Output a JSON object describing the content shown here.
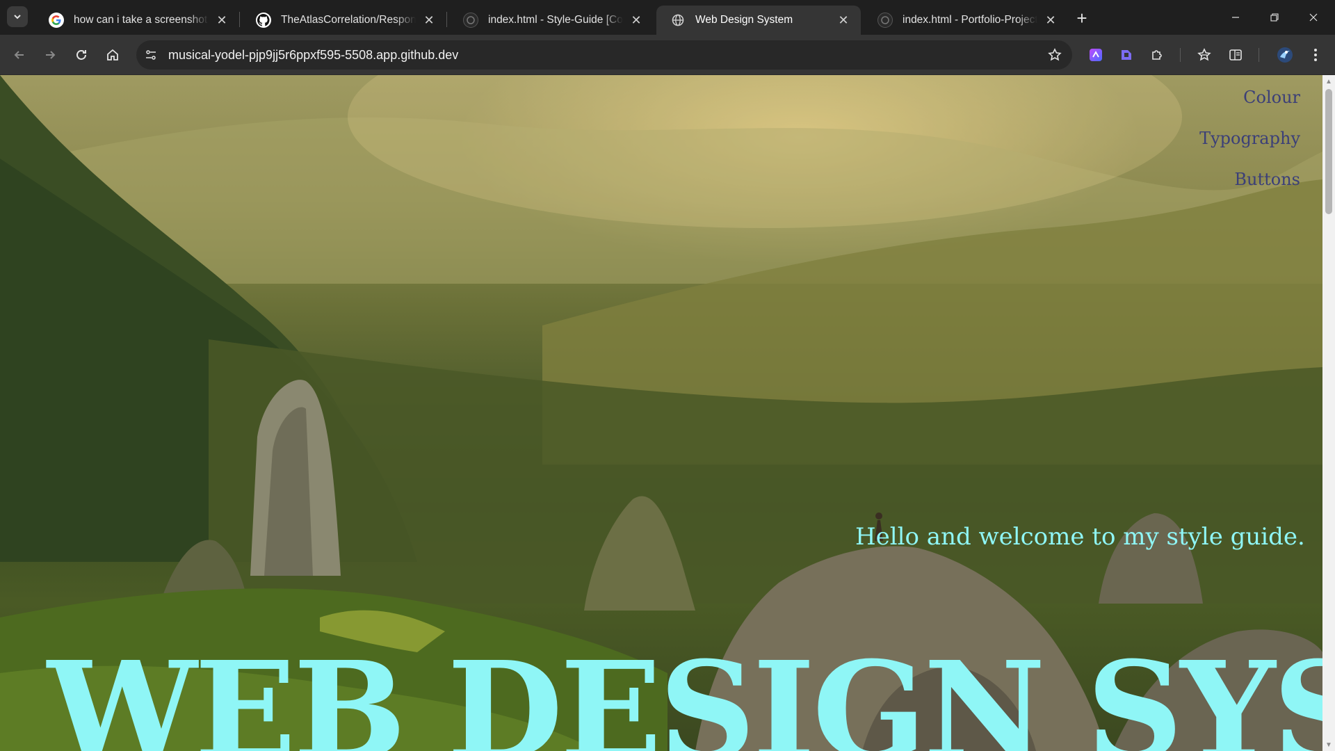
{
  "browser": {
    "tabs": [
      {
        "title": "how can i take a screenshot on",
        "favicon": "google-icon",
        "active": false
      },
      {
        "title": "TheAtlasCorrelation/Responsive",
        "favicon": "github-icon",
        "active": false
      },
      {
        "title": "index.html - Style-Guide [Codes",
        "favicon": "codespaces-icon",
        "active": false
      },
      {
        "title": "Web Design System",
        "favicon": "globe-icon",
        "active": true
      },
      {
        "title": "index.html - Portfolio-Project [C",
        "favicon": "codespaces-icon",
        "active": false
      }
    ],
    "new_tab_label": "+",
    "address": "musical-yodel-pjp9jj5r6ppxf595-5508.app.github.dev"
  },
  "page": {
    "nav": {
      "colour": "Colour",
      "typography": "Typography",
      "buttons": "Buttons"
    },
    "welcome": "Hello and welcome to my style guide.",
    "hero_title": "WEB DESIGN SYSTEM"
  },
  "colors": {
    "accent_text": "#8ff6f6",
    "nav_text": "#3b3f78",
    "browser_frame": "#1f1f1f",
    "toolbar": "#353535"
  }
}
